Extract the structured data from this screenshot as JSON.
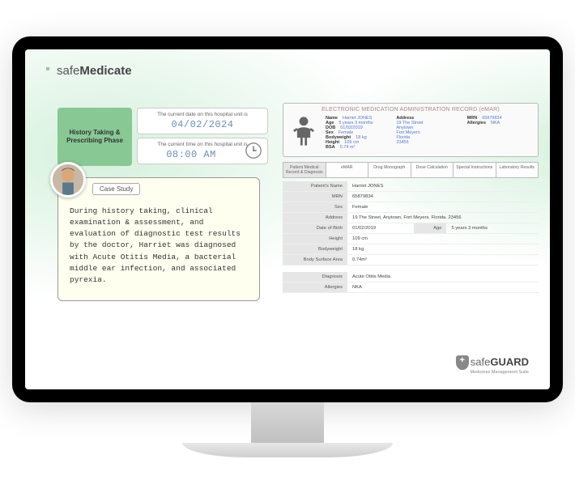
{
  "logo": {
    "plain": "safe",
    "bold": "Medicate"
  },
  "phase": {
    "title": "History Taking & Prescribing Phase"
  },
  "datebox": {
    "label": "The current date on this hospital unit is",
    "value": "04/02/2024"
  },
  "timebox": {
    "label": "The current time on this hospital unit is",
    "value": "08:00 AM"
  },
  "casestudy": {
    "tab": "Case Study",
    "text": "During history taking, clinical examination & assessment, and evaluation of diagnostic test results by the doctor, Harriet was diagnosed with Acute Otitis Media, a bacterial middle ear infection, and associated pyrexia."
  },
  "emar": {
    "title": "ELECTRONIC MEDICATION ADMINISTRATION RECORD (eMAR)",
    "header": {
      "name_l": "Name",
      "name_v": "Harriet JONES",
      "age_l": "Age",
      "age_v": "5 years 3 months",
      "dob_l": "DOB",
      "dob_v": "01/02/2019",
      "sex_l": "Sex",
      "sex_v": "Female",
      "bw_l": "Bodyweight",
      "bw_v": "18 kg",
      "ht_l": "Height",
      "ht_v": "109 cm",
      "bsa_l": "BSA",
      "bsa_v": "0.74 m²",
      "addr_l": "Address",
      "addr_v1": "19 The Street",
      "addr_v2": "Anytown",
      "addr_v3": "Fort Meyers",
      "addr_v4": "Florida",
      "addr_v5": "23456",
      "mrn_l": "MRN",
      "mrn_v": "65879834",
      "all_l": "Allergies",
      "all_v": "NKA"
    },
    "tabs": [
      "Patient Medical Record & Diagnosis",
      "eMAR",
      "Drug Monograph",
      "Dose Calculation",
      "Special Instructions",
      "Laboratory Results"
    ],
    "details": {
      "pname_l": "Patient's Name",
      "pname_v": "Harriet JONES",
      "mrn_l": "MRN",
      "mrn_v": "65879834",
      "sex_l": "Sex",
      "sex_v": "Female",
      "addr_l": "Address",
      "addr_v": "19 The Street, Anytown, Fort Meyers, Florida. 23456",
      "dob_l": "Date of Birth",
      "dob_v": "01/02/2019",
      "age_l": "Age",
      "age_v": "5 years 3 months",
      "ht_l": "Height",
      "ht_v": "109 cm",
      "bw_l": "Bodyweight",
      "bw_v": "18 kg",
      "bsa_l": "Body Surface Area",
      "bsa_v": "0.74m²",
      "dx_l": "Diagnosis",
      "dx_v": "Acute Otitis Media",
      "alg_l": "Allergies",
      "alg_v": "NKA"
    }
  },
  "guard": {
    "plain": "safe",
    "bold": "GUARD",
    "sub": "Medicines Management Suite"
  }
}
